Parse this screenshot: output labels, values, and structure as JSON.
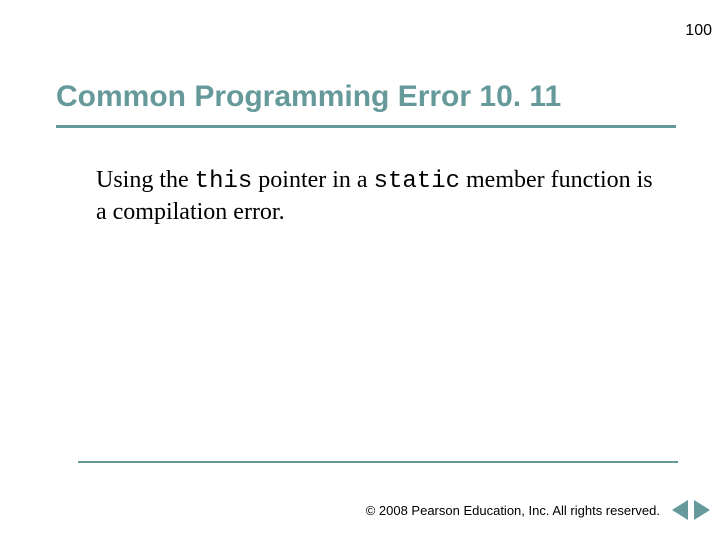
{
  "page_number": "100",
  "title": "Common Programming Error 10. 11",
  "body": {
    "pre1": "Using the ",
    "code1": "this",
    "mid1": " pointer in a ",
    "code2": "static",
    "post1": " member function is a compilation error."
  },
  "copyright": "© 2008 Pearson Education, Inc. All rights reserved.",
  "nav": {
    "prev": "previous-slide",
    "next": "next-slide"
  }
}
